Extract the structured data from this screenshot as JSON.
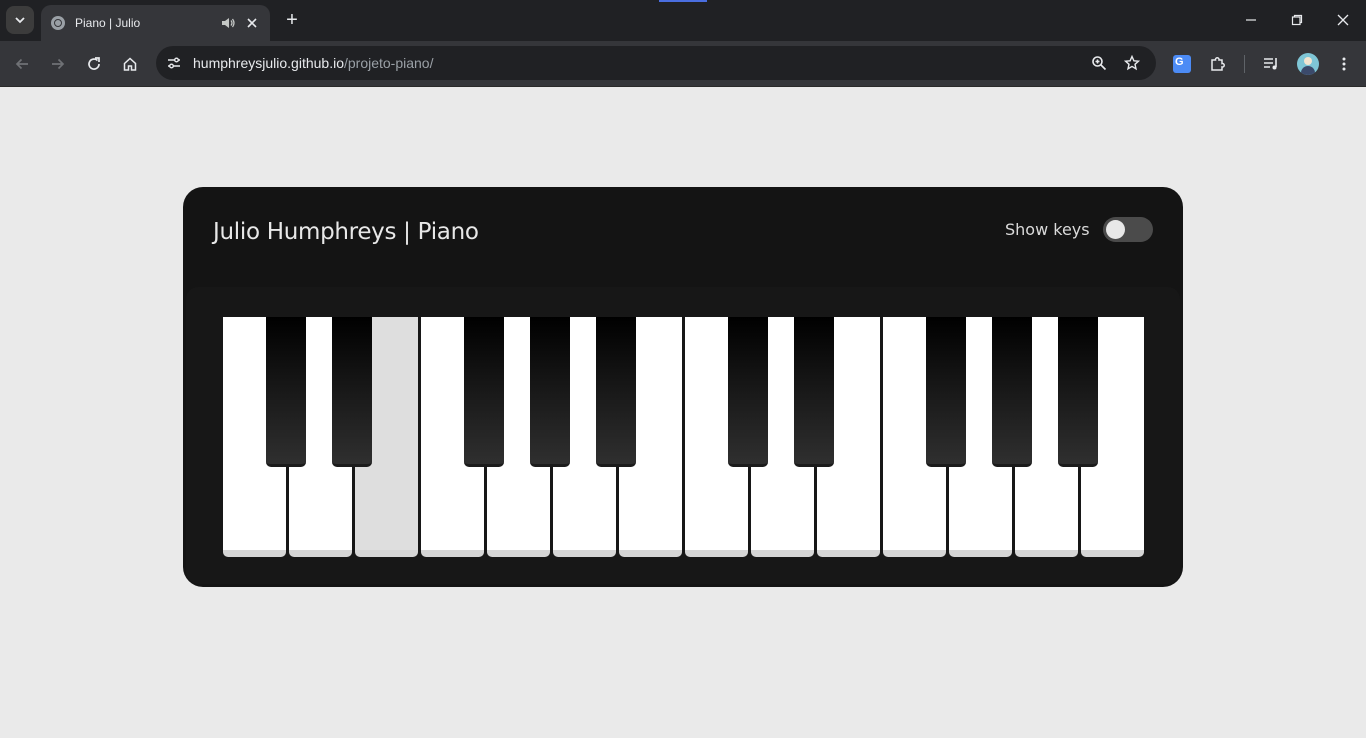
{
  "browser": {
    "tab_title": "Piano | Julio",
    "url_host": "humphreysjulio.github.io",
    "url_path": "/projeto-piano/",
    "new_tab_symbol": "+",
    "icons": [
      "tab-search-icon",
      "globe-icon",
      "speaker-icon",
      "close-icon",
      "back-icon",
      "forward-icon",
      "reload-icon",
      "home-icon",
      "site-settings-icon",
      "zoom-icon",
      "star-icon",
      "translate-icon",
      "extensions-icon",
      "media-icon",
      "profile-avatar",
      "menu-icon",
      "minimize-icon",
      "restore-icon",
      "window-close-icon"
    ]
  },
  "app": {
    "title": "Julio Humphreys | Piano",
    "show_keys_label": "Show keys",
    "show_keys_on": false
  },
  "piano": {
    "white_key_count": 14,
    "black_key_count": 10,
    "pressed_white_key_index": 2,
    "colors": {
      "white_key": "#ffffff",
      "pressed_key": "#dedede",
      "black_key": "#000000",
      "card_background": "#141414",
      "page_background": "#eaeaea"
    }
  }
}
